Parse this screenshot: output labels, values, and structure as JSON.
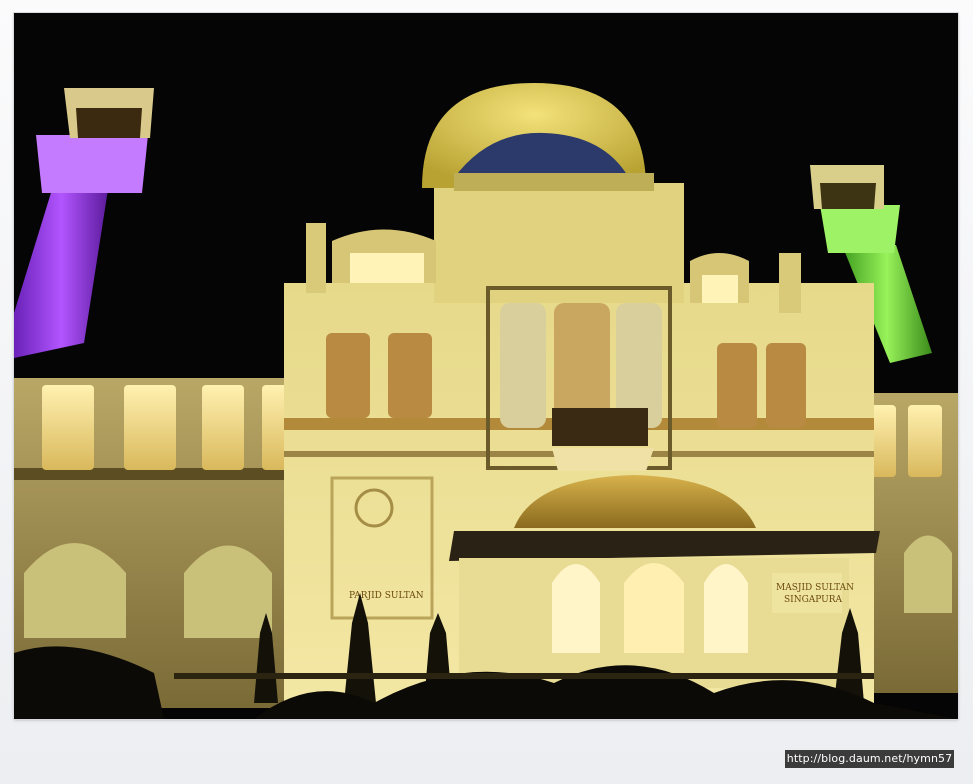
{
  "photo": {
    "subject": "Masjid Sultan",
    "sign_left_line1": "PARJID SULTAN",
    "sign_right_line1": "MASJID SULTAN",
    "sign_right_line2": "SINGAPURA"
  },
  "watermark": {
    "text": "http://blog.daum.net/hymn57"
  },
  "colors": {
    "sky": "#050505",
    "facade": "#e9dc8c",
    "dome": "#e3d15a",
    "left_minaret": "#9a3fe0",
    "right_minaret": "#7ee04a",
    "watermark_bg": "#3b3b3b"
  }
}
